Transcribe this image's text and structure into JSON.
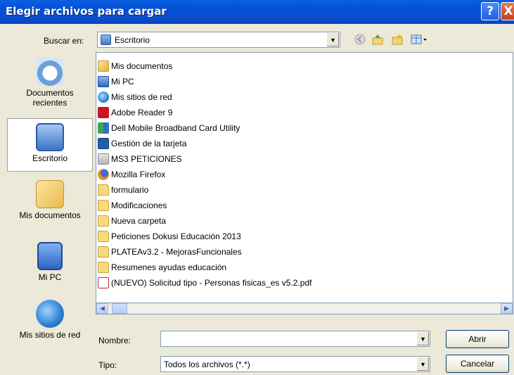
{
  "window": {
    "title": "Elegir archivos para cargar",
    "help_label": "?",
    "close_label": "X"
  },
  "look_in": {
    "label": "Buscar en:",
    "value": "Escritorio"
  },
  "toolbar": {
    "icons": [
      "back-icon",
      "up-folder-icon",
      "new-folder-icon",
      "view-menu-icon"
    ]
  },
  "places": [
    {
      "label_lines": [
        "Documentos",
        "recientes"
      ],
      "icon": "recent-documents-icon"
    },
    {
      "label_lines": [
        "Escritorio"
      ],
      "icon": "desktop-icon",
      "selected": true
    },
    {
      "label_lines": [
        "Mis documentos"
      ],
      "icon": "my-documents-icon"
    },
    {
      "label_lines": [
        "Mi PC"
      ],
      "icon": "my-computer-icon"
    },
    {
      "label_lines": [
        "Mis sitios de red"
      ],
      "icon": "network-places-icon"
    }
  ],
  "files": [
    {
      "name": "Mis documentos",
      "icon": "my-documents-icon"
    },
    {
      "name": "Mi PC",
      "icon": "my-computer-icon"
    },
    {
      "name": "Mis sitios de red",
      "icon": "network-places-icon"
    },
    {
      "name": "Adobe Reader 9",
      "icon": "adobe-reader-icon"
    },
    {
      "name": "Dell Mobile Broadband Card Utility",
      "icon": "dell-utility-icon"
    },
    {
      "name": "Gestión de la tarjeta",
      "icon": "card-manager-icon"
    },
    {
      "name": "MS3 PETICIONES",
      "icon": "shortcut-icon"
    },
    {
      "name": "Mozilla Firefox",
      "icon": "firefox-icon"
    },
    {
      "name": "formulario",
      "icon": "folder-icon"
    },
    {
      "name": "Modificaciones",
      "icon": "folder-icon"
    },
    {
      "name": "Nueva carpeta",
      "icon": "folder-icon"
    },
    {
      "name": "Peticiones Dokusi Educación 2013",
      "icon": "folder-icon"
    },
    {
      "name": "PLATEAv3.2 - MejorasFuncionales",
      "icon": "folder-icon"
    },
    {
      "name": "Resumenes ayudas educación",
      "icon": "folder-icon"
    },
    {
      "name": "(NUEVO) Solicitud tipo - Personas fisicas_es v5.2.pdf",
      "icon": "pdf-file-icon"
    }
  ],
  "filename": {
    "label": "Nombre:",
    "value": ""
  },
  "filetype": {
    "label": "Tipo:",
    "value": "Todos los archivos (*.*)"
  },
  "buttons": {
    "open": "Abrir",
    "cancel": "Cancelar"
  },
  "colors": {
    "titlebar": "#0a55d8",
    "dialog_bg": "#ece9d8",
    "folder": "#f6d97a"
  }
}
